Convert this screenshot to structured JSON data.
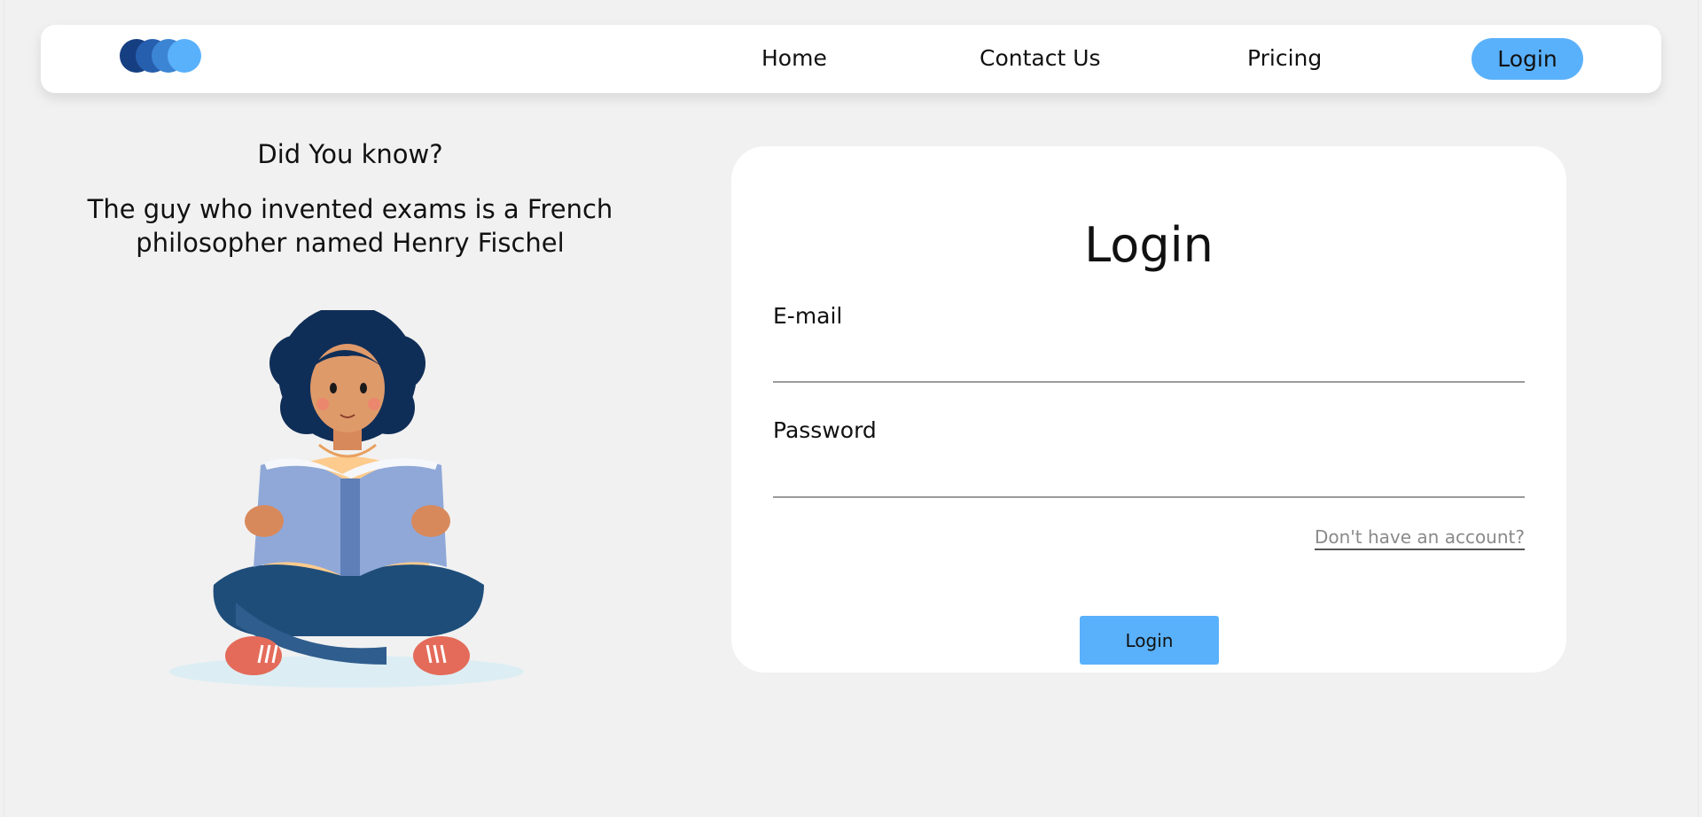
{
  "nav": {
    "logo_colors": [
      "#163f82",
      "#265fae",
      "#3c85d4",
      "#5ab1fb"
    ],
    "links": [
      "Home",
      "Contact Us",
      "Pricing"
    ],
    "login_label": "Login"
  },
  "fact": {
    "heading": "Did You know?",
    "body": "The guy who invented exams is a French philosopher named Henry Fischel"
  },
  "login": {
    "title": "Login",
    "email_label": "E-mail",
    "email_value": "",
    "password_label": "Password",
    "password_value": "",
    "signup_link": "Don't have an account?",
    "submit_label": "Login"
  },
  "colors": {
    "accent": "#5ab1fb",
    "background": "#f1f1f1",
    "card": "#ffffff"
  }
}
